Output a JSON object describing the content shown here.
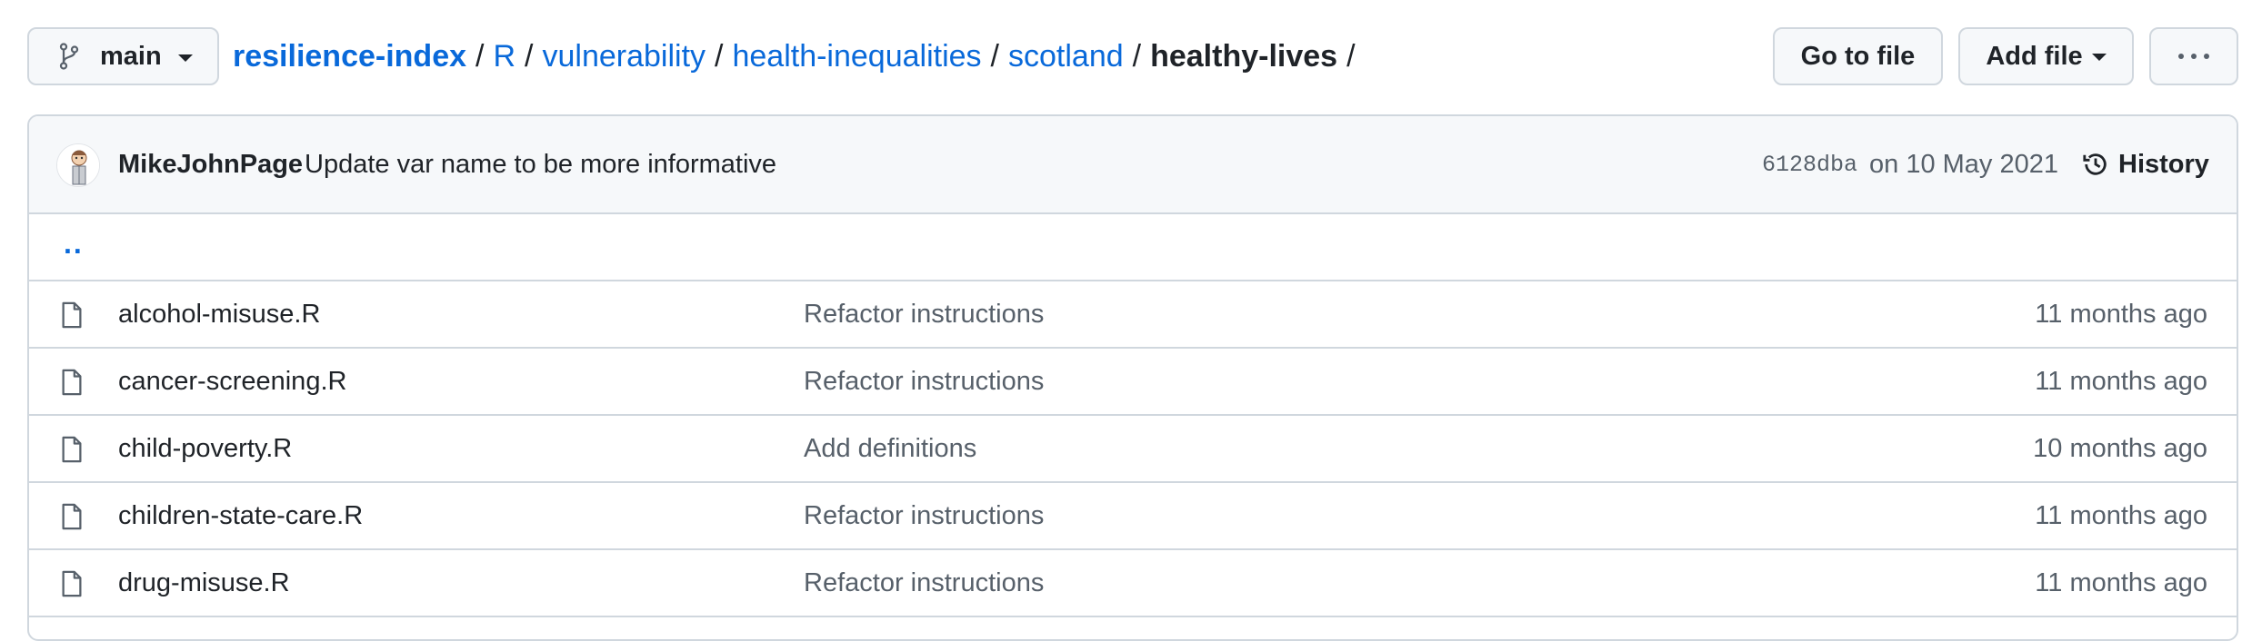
{
  "branch": {
    "name": "main",
    "icon": "git-branch-icon"
  },
  "breadcrumb": {
    "repo": "resilience-index",
    "path": [
      "R",
      "vulnerability",
      "health-inequalities",
      "scotland"
    ],
    "current": "healthy-lives",
    "separator": "/"
  },
  "actions": {
    "go_to_file": "Go to file",
    "add_file": "Add file",
    "more_icon": "kebab-horizontal-icon"
  },
  "commit": {
    "author": "MikeJohnPage",
    "message": "Update var name to be more informative",
    "sha": "6128dba",
    "date": "on 10 May 2021",
    "history_label": "History",
    "history_icon": "history-icon"
  },
  "parent_dir": "..",
  "files": [
    {
      "name": "alcohol-misuse.R",
      "message": "Refactor instructions",
      "age": "11 months ago"
    },
    {
      "name": "cancer-screening.R",
      "message": "Refactor instructions",
      "age": "11 months ago"
    },
    {
      "name": "child-poverty.R",
      "message": "Add definitions",
      "age": "10 months ago"
    },
    {
      "name": "children-state-care.R",
      "message": "Refactor instructions",
      "age": "11 months ago"
    },
    {
      "name": "drug-misuse.R",
      "message": "Refactor instructions",
      "age": "11 months ago"
    }
  ],
  "colors": {
    "link": "#0969da",
    "text": "#1f2328",
    "muted": "#57606a",
    "border": "#d0d7de",
    "header_bg": "#f6f8fa"
  }
}
